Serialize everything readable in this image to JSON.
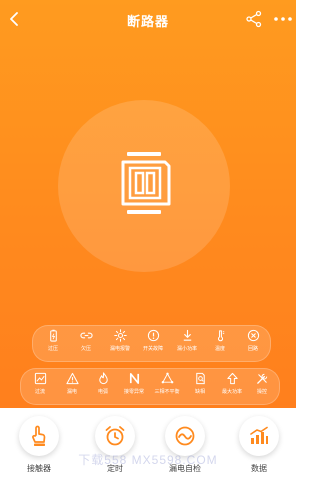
{
  "header": {
    "title": "断路器",
    "back_icon": "chevron-left-icon",
    "share_icon": "share-icon",
    "more_icon": "more-horizontal-icon"
  },
  "colors": {
    "primary_orange": "#ff8a1e",
    "icon_orange": "#ff8a1e",
    "white": "#ffffff",
    "nav_label": "#444444"
  },
  "device": {
    "icon": "circuit-breaker-icon"
  },
  "status_row": [
    {
      "label": "过压",
      "icon": "battery-icon"
    },
    {
      "label": "欠压",
      "icon": "link-broken-icon"
    },
    {
      "label": "漏电报警",
      "icon": "spark-icon"
    },
    {
      "label": "开关故障",
      "icon": "alert-circle-icon"
    },
    {
      "label": "漏小功率",
      "icon": "download-arrow-icon"
    },
    {
      "label": "温度",
      "icon": "thermometer-icon"
    },
    {
      "label": "回路",
      "icon": "close-circle-icon"
    }
  ],
  "params_row": [
    {
      "label": "过流",
      "icon": "image-trend-icon"
    },
    {
      "label": "漏电",
      "icon": "warning-triangle-icon"
    },
    {
      "label": "电弧",
      "icon": "flame-icon"
    },
    {
      "label": "接零异常",
      "icon": "n-letter-icon"
    },
    {
      "label": "三相不平衡",
      "icon": "triangle-nodes-icon"
    },
    {
      "label": "缺相",
      "icon": "document-search-icon"
    },
    {
      "label": "最大功率",
      "icon": "upload-arrow-icon"
    },
    {
      "label": "操控",
      "icon": "tools-icon"
    }
  ],
  "bottom_nav": [
    {
      "label": "接触器",
      "icon": "touch-hand-icon"
    },
    {
      "label": "定时",
      "icon": "alarm-clock-icon"
    },
    {
      "label": "漏电自检",
      "icon": "gauge-check-icon"
    },
    {
      "label": "数据",
      "icon": "bar-chart-icon"
    }
  ],
  "watermark": "下载558  MX5598.COM"
}
